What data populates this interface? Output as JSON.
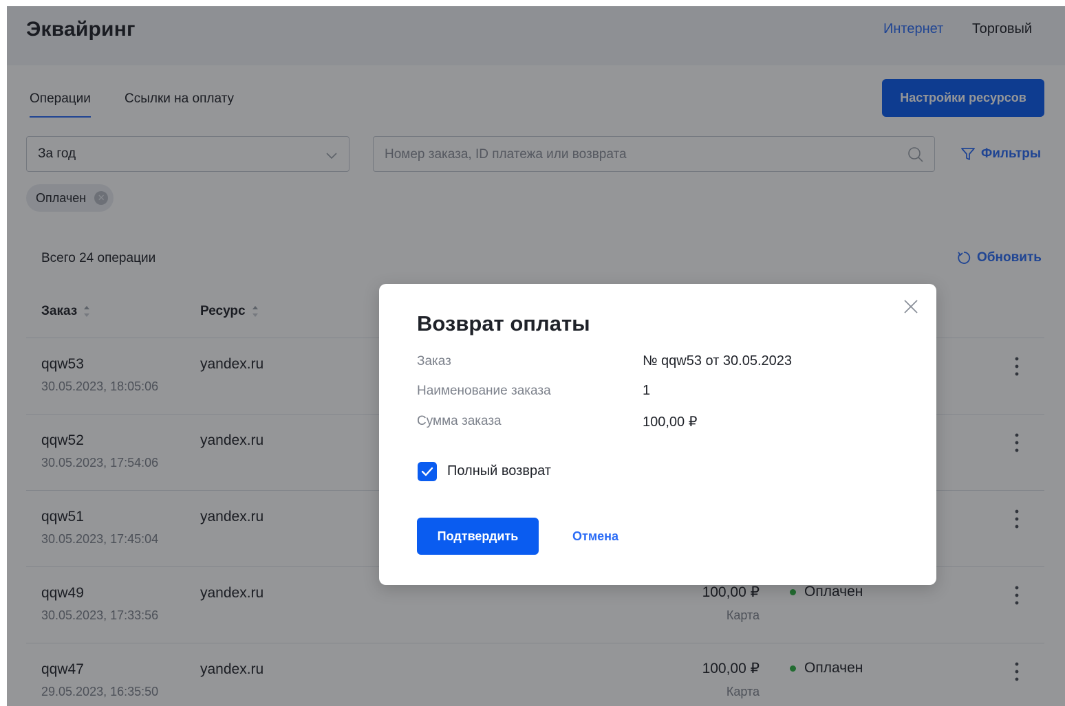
{
  "header": {
    "title": "Эквайринг",
    "link_internet": "Интернет",
    "link_trade": "Торговый"
  },
  "tabs": [
    {
      "label": "Операции",
      "active": true
    },
    {
      "label": "Ссылки на оплату",
      "active": false
    }
  ],
  "resources_button": "Настройки ресурсов",
  "filters": {
    "period_value": "За год",
    "search_placeholder": "Номер заказа, ID платежа или возврата",
    "filters_label": "Фильтры",
    "chip_label": "Оплачен"
  },
  "summary": {
    "total": "Всего 24 операции",
    "refresh_label": "Обновить"
  },
  "table": {
    "columns": [
      "Заказ",
      "Ресурс"
    ],
    "rows": [
      {
        "id": "qqw53",
        "datetime": "30.05.2023, 18:05:06",
        "resource": "yandex.ru",
        "amount": "",
        "method": "",
        "status": ""
      },
      {
        "id": "qqw52",
        "datetime": "30.05.2023, 17:54:06",
        "resource": "yandex.ru",
        "amount": "",
        "method": "",
        "status": ""
      },
      {
        "id": "qqw51",
        "datetime": "30.05.2023, 17:45:04",
        "resource": "yandex.ru",
        "amount": "",
        "method": "",
        "status": ""
      },
      {
        "id": "qqw49",
        "datetime": "30.05.2023, 17:33:56",
        "resource": "yandex.ru",
        "amount": "100,00 ₽",
        "method": "Карта",
        "status": "Оплачен"
      },
      {
        "id": "qqw47",
        "datetime": "29.05.2023, 16:35:50",
        "resource": "yandex.ru",
        "amount": "100,00 ₽",
        "method": "Карта",
        "status": "Оплачен"
      }
    ]
  },
  "modal": {
    "title": "Возврат оплаты",
    "order_label": "Заказ",
    "order_value": "№ qqw53 от 30.05.2023",
    "name_label": "Наименование заказа",
    "name_value": "1",
    "sum_label": "Сумма заказа",
    "sum_value": "100,00 ₽",
    "full_refund_label": "Полный возврат",
    "full_refund_checked": true,
    "confirm_label": "Подтвердить",
    "cancel_label": "Отмена"
  },
  "colors": {
    "accent": "#0a5cf0",
    "link": "#2b6cf6",
    "status_paid": "#2fb344"
  }
}
